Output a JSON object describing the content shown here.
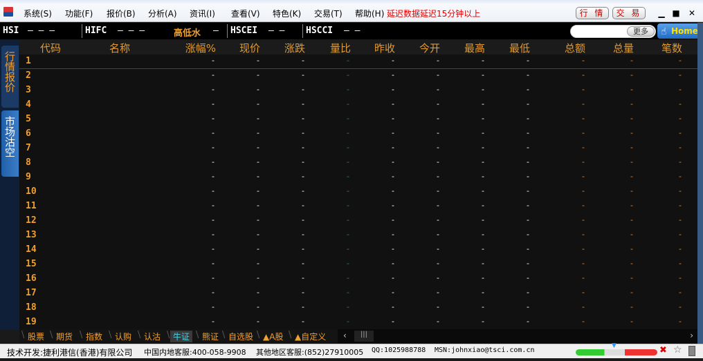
{
  "menu": [
    "系统(S)",
    "功能(F)",
    "报价(B)",
    "分析(A)",
    "资讯(I)",
    "查看(V)",
    "特色(K)",
    "交易(T)",
    "帮助(H)"
  ],
  "delay_notice": "延迟数据延迟15分钟以上",
  "top_buttons": {
    "quote": "行 情",
    "trade": "交 易"
  },
  "window_controls": {
    "minimize": "▁",
    "maximize": "■",
    "close": "✕"
  },
  "index_bar": {
    "hsi": "HSI",
    "hsi_vals": "—  —  —",
    "hifc": "HIFC",
    "hifc_vals": "—  —  —",
    "highlow": "高低水",
    "highlow_val": "—",
    "hscei": "HSCEI",
    "hscei_vals": "—  —",
    "hscci": "HSCCI",
    "hscci_vals": "—  —"
  },
  "search": {
    "placeholder": "",
    "more": "更多",
    "home": "Home"
  },
  "sidebar": [
    "行情报价",
    "市场沽空"
  ],
  "columns": [
    "代码",
    "名称",
    "涨幅%",
    "现价",
    "涨跌",
    "量比",
    "昨收",
    "今开",
    "最高",
    "最低",
    "总额",
    "总量",
    "笔数"
  ],
  "rows": [
    {
      "no": "1",
      "v": [
        "-",
        "-",
        "-",
        "-",
        "-",
        "-",
        "-",
        "-",
        "-",
        "-",
        "-"
      ]
    },
    {
      "no": "2",
      "v": [
        "-",
        "-",
        "-",
        "-",
        "-",
        "-",
        "-",
        "-",
        "-",
        "-",
        "-"
      ]
    },
    {
      "no": "3",
      "v": [
        "-",
        "-",
        "-",
        "-",
        "-",
        "-",
        "-",
        "-",
        "-",
        "-",
        "-"
      ]
    },
    {
      "no": "4",
      "v": [
        "-",
        "-",
        "-",
        "-",
        "-",
        "-",
        "-",
        "-",
        "-",
        "-",
        "-"
      ]
    },
    {
      "no": "5",
      "v": [
        "-",
        "-",
        "-",
        "-",
        "-",
        "-",
        "-",
        "-",
        "-",
        "-",
        "-"
      ]
    },
    {
      "no": "6",
      "v": [
        "-",
        "-",
        "-",
        "-",
        "-",
        "-",
        "-",
        "-",
        "-",
        "-",
        "-"
      ]
    },
    {
      "no": "7",
      "v": [
        "-",
        "-",
        "-",
        "-",
        "-",
        "-",
        "-",
        "-",
        "-",
        "-",
        "-"
      ]
    },
    {
      "no": "8",
      "v": [
        "-",
        "-",
        "-",
        "-",
        "-",
        "-",
        "-",
        "-",
        "-",
        "-",
        "-"
      ]
    },
    {
      "no": "9",
      "v": [
        "-",
        "-",
        "-",
        "-",
        "-",
        "-",
        "-",
        "-",
        "-",
        "-",
        "-"
      ]
    },
    {
      "no": "10",
      "v": [
        "-",
        "-",
        "-",
        "-",
        "-",
        "-",
        "-",
        "-",
        "-",
        "-",
        "-"
      ]
    },
    {
      "no": "11",
      "v": [
        "-",
        "-",
        "-",
        "-",
        "-",
        "-",
        "-",
        "-",
        "-",
        "-",
        "-"
      ]
    },
    {
      "no": "12",
      "v": [
        "-",
        "-",
        "-",
        "-",
        "-",
        "-",
        "-",
        "-",
        "-",
        "-",
        "-"
      ]
    },
    {
      "no": "13",
      "v": [
        "-",
        "-",
        "-",
        "-",
        "-",
        "-",
        "-",
        "-",
        "-",
        "-",
        "-"
      ]
    },
    {
      "no": "14",
      "v": [
        "-",
        "-",
        "-",
        "-",
        "-",
        "-",
        "-",
        "-",
        "-",
        "-",
        "-"
      ]
    },
    {
      "no": "15",
      "v": [
        "-",
        "-",
        "-",
        "-",
        "-",
        "-",
        "-",
        "-",
        "-",
        "-",
        "-"
      ]
    },
    {
      "no": "16",
      "v": [
        "-",
        "-",
        "-",
        "-",
        "-",
        "-",
        "-",
        "-",
        "-",
        "-",
        "-"
      ]
    },
    {
      "no": "17",
      "v": [
        "-",
        "-",
        "-",
        "-",
        "-",
        "-",
        "-",
        "-",
        "-",
        "-",
        "-"
      ]
    },
    {
      "no": "18",
      "v": [
        "-",
        "-",
        "-",
        "-",
        "-",
        "-",
        "-",
        "-",
        "-",
        "-",
        "-"
      ]
    },
    {
      "no": "19",
      "v": [
        "-",
        "-",
        "-",
        "-",
        "-",
        "-",
        "-",
        "-",
        "-",
        "-",
        "-"
      ]
    }
  ],
  "value_colors": [
    "#ffffff",
    "#ffffff",
    "#ffffff",
    "#3a8a3a",
    "#ffffff",
    "#ffffff",
    "#ffffff",
    "#ffffff",
    "#e08a30",
    "#e08a30",
    "#e08a30"
  ],
  "bottom_tabs": [
    "股票",
    "期货",
    "指数",
    "认购",
    "认沽",
    "牛证",
    "熊证",
    "自选股",
    "▲A股",
    "▲自定义"
  ],
  "active_tab": 5,
  "status": {
    "dev": "技术开发:捷利港信(香港)有限公司",
    "cn": "中国内地客服:400-058-9908",
    "other": "其他地区客服:(852)27910005",
    "qq": "QQ:1025988788",
    "msn": "MSN:johnxiao@tsci.com.cn"
  }
}
